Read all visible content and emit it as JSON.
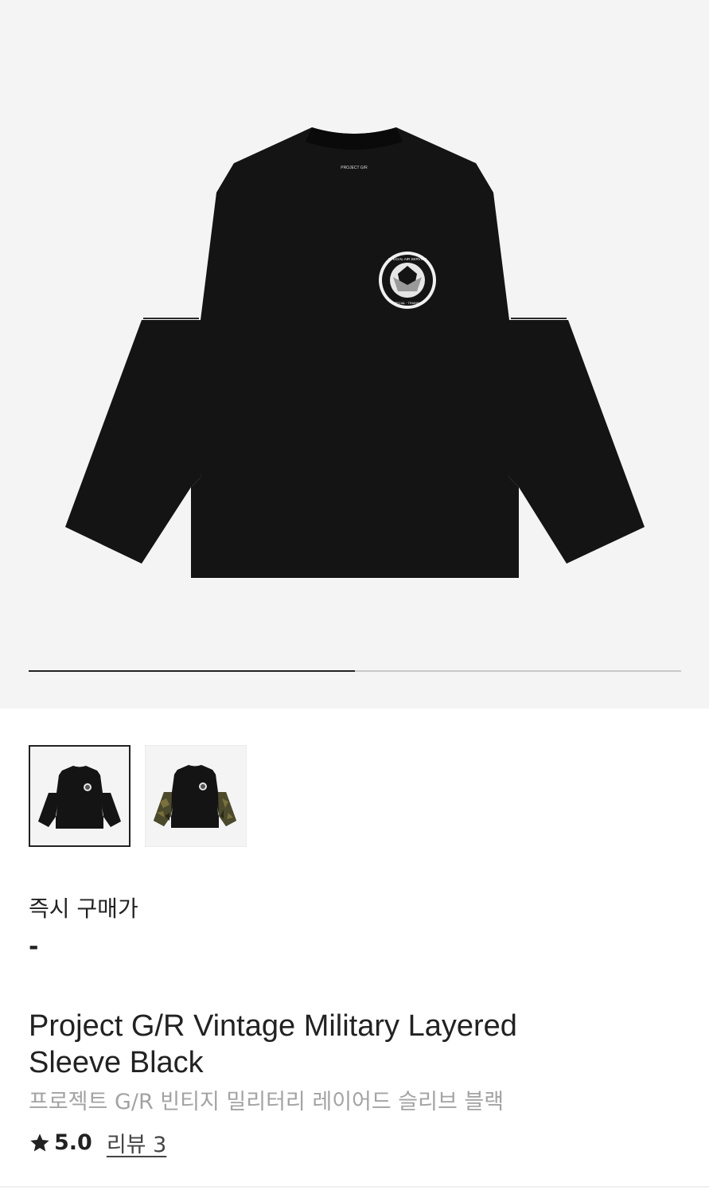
{
  "product_image": {
    "collar_label": "PROJECT G/R",
    "emblem_top_text": "SPECIAL AIR SERVICE",
    "emblem_bottom_text": "SPECIAL · TRAINING",
    "gallery_progress": 0.5
  },
  "thumbnails": [
    {
      "variant": "black",
      "selected": true
    },
    {
      "variant": "camo-sleeve",
      "selected": false
    }
  ],
  "price": {
    "label": "즉시 구매가",
    "value": "-"
  },
  "product": {
    "title": "Project G/R Vintage Military Layered Sleeve Black",
    "subtitle": "프로젝트 G/R 빈티지 밀리터리 레이어드 슬리브 블랙"
  },
  "rating": {
    "icon": "star-icon",
    "score": "5.0",
    "review_link": "리뷰 3"
  },
  "colors": {
    "hero_bg": "#f4f4f4",
    "shirt": "#141414",
    "subtitle_gray": "#a3a3a3"
  }
}
